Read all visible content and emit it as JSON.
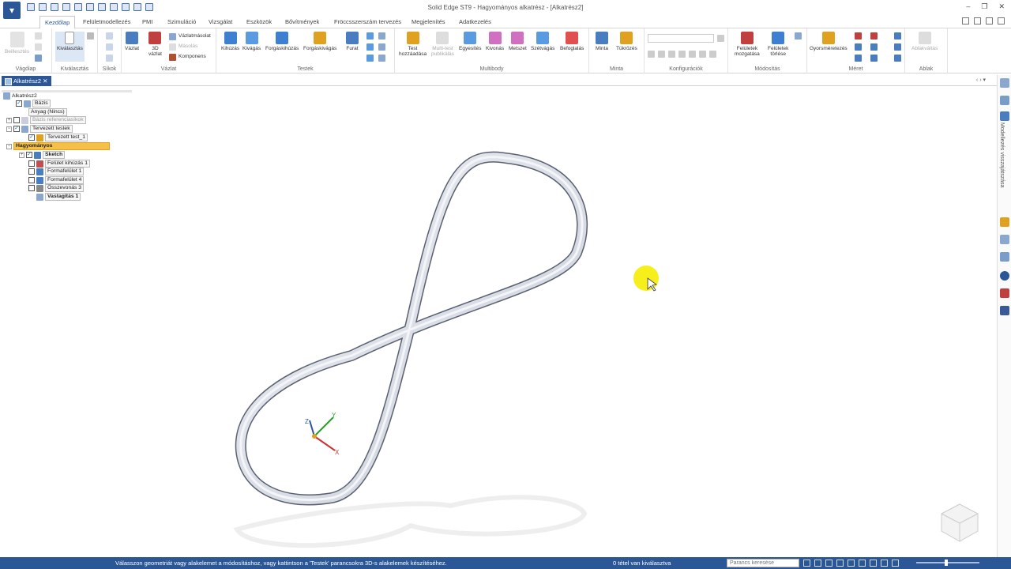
{
  "app": {
    "title": "Solid Edge ST9 - Hagyományos alkatrész - [Alkatrész2]"
  },
  "ribbon_tabs": [
    "Kezdőlap",
    "Felületmodellezés",
    "PMI",
    "Szimuláció",
    "Vizsgálat",
    "Eszközök",
    "Bővítmények",
    "Fröccsszerszám tervezés",
    "Megjelenítés",
    "Adatkezelés"
  ],
  "groups": {
    "vagolap": "Vágólap",
    "kivalasztas": "Kiválasztás",
    "sikok": "Síkok",
    "vazlat": "Vázlat",
    "testek": "Testek",
    "multibody": "Multibody",
    "minta": "Minta",
    "konfig": "Konfigurációk",
    "modositas": "Módosítás",
    "meret": "Méret",
    "ablak": "Ablak"
  },
  "buttons": {
    "beillesztes": "Beillesztés",
    "kivalasztas": "Kiválasztás",
    "vazlat": "Vázlat",
    "vazlat3d_1": "3D",
    "vazlat3d_2": "vázlat",
    "vazlatmasolat": "Vázlatmásolat",
    "masolas": "Másolás",
    "komponens": "Komponens",
    "kihuzas": "Kihúzás",
    "kivagas": "Kivágás",
    "forgaskihuzas": "Forgáskihúzás",
    "forgaskivagas": "Forgáskivágás",
    "furat": "Furat",
    "test_1": "Test",
    "test_2": "hozzáadása",
    "multitest_1": "Multi-test",
    "multitest_2": "publikálás",
    "egyesites": "Egyesítés",
    "kivonas": "Kivonás",
    "metszet": "Metszet",
    "szetvagas": "Szétvágás",
    "befoglalas": "Befoglalás",
    "minta": "Minta",
    "tukrozes": "Tükrözés",
    "feluletek_mozg_1": "Felületek",
    "feluletek_mozg_2": "mozgatása",
    "feluletek_tor_1": "Felületek",
    "feluletek_tor_2": "törlése",
    "gyorsmeretezes": "Gyorsméretezés",
    "ablakvaltas": "Ablakváltás"
  },
  "doc_tab": "Alkatrész2",
  "tree": {
    "root": "Alkatrész2",
    "bazis": "Bázis",
    "anyag": "Anyag (Nincs)",
    "bazis_ref": "Bázis referenciasíkok",
    "tervezett": "Tervezett testek",
    "tervezett_1": "Tervezett test_1",
    "hagyomanyos": "Hagyományos",
    "sketch": "Sketch",
    "felulet_kihuzas": "Felület kihúzás 1",
    "forma1": "Formafelület 1",
    "forma4": "Formafelület 4",
    "osszevonas": "Összevonás 3",
    "vastagitas": "Vastagítás 1"
  },
  "right_panel_label": "Modellezés visszajátszása",
  "axes": {
    "x": "X",
    "y": "Y",
    "z": "Z"
  },
  "status": {
    "message": "Válasszon geometriát vagy alakelemet a módosításhoz, vagy kattintson a 'Testek' parancsokra 3D-s alakelemek készítéséhez.",
    "count": "0 tétel van kiválasztva",
    "command_placeholder": "Parancs keresése"
  },
  "colors": {
    "accent": "#2b5797",
    "selection": "#f5c04a",
    "model": "#dde1ea"
  }
}
